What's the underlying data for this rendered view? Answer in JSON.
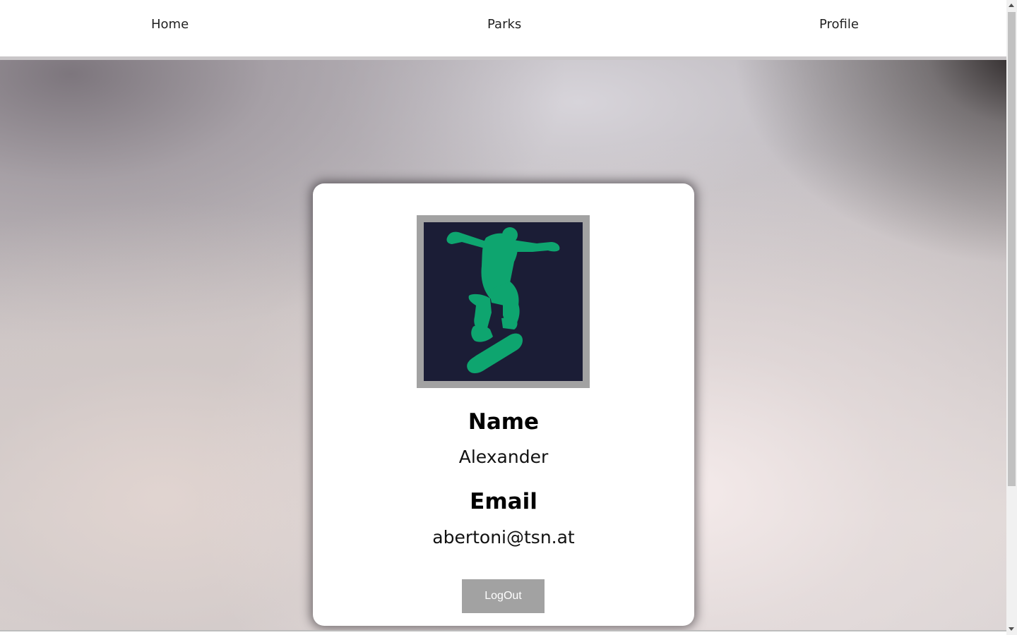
{
  "nav": {
    "items": [
      {
        "label": "Home"
      },
      {
        "label": "Parks"
      },
      {
        "label": "Profile"
      }
    ]
  },
  "profile": {
    "avatar_icon": "skateboarder-icon",
    "avatar_colors": {
      "background": "#1b1d36",
      "figure": "#0ea56f",
      "frame": "#a2a2a2"
    },
    "name_label": "Name",
    "name_value": "Alexander",
    "email_label": "Email",
    "email_value": "abertoni@tsn.at",
    "logout_label": "LogOut"
  }
}
